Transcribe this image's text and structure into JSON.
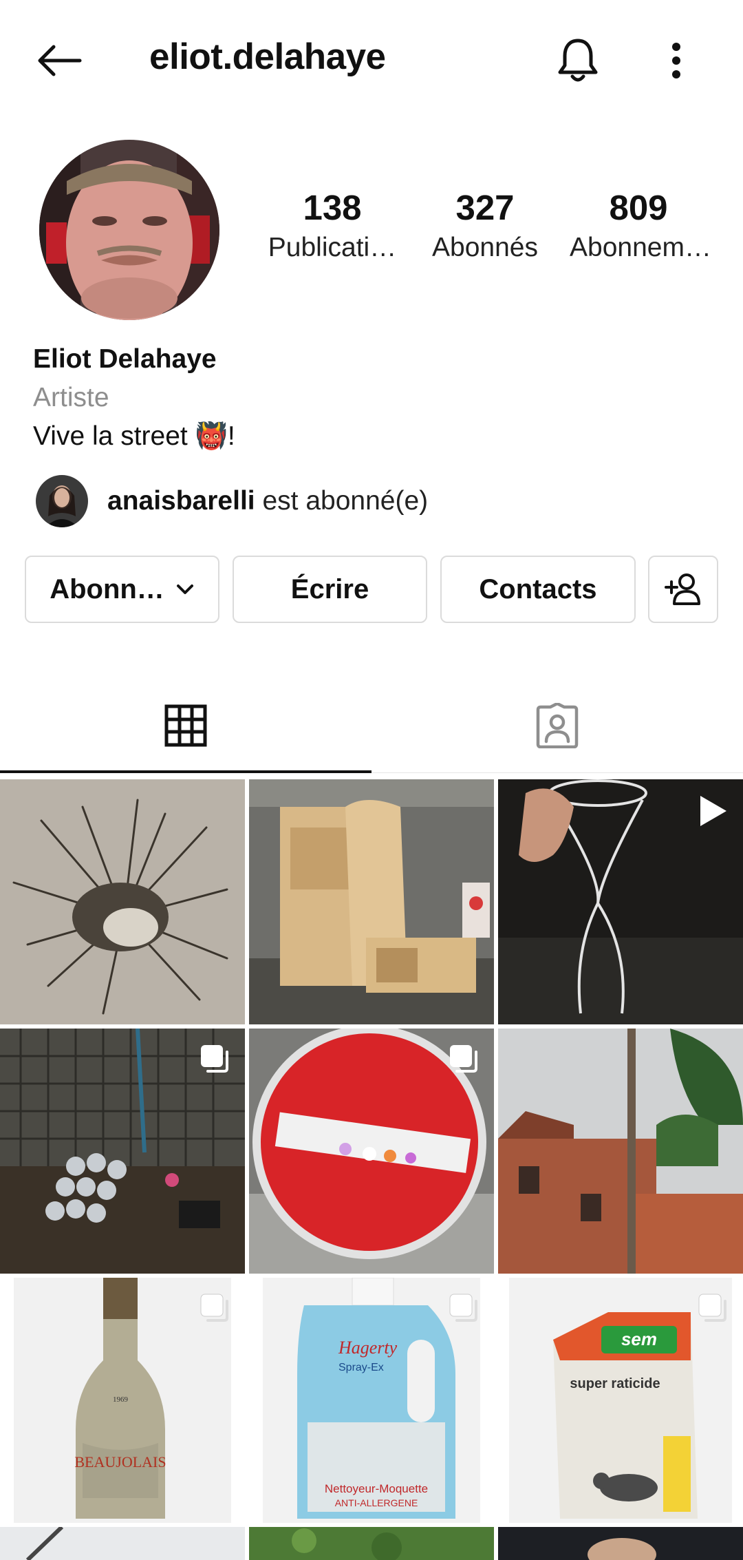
{
  "header": {
    "username": "eliot.delahaye",
    "back_icon": "arrow-left-icon",
    "bell_icon": "bell-icon",
    "more_icon": "more-vertical-icon"
  },
  "profile": {
    "stats": [
      {
        "value": "138",
        "label": "Publicati…"
      },
      {
        "value": "327",
        "label": "Abonnés"
      },
      {
        "value": "809",
        "label": "Abonnem…"
      }
    ],
    "name": "Eliot Delahaye",
    "category": "Artiste",
    "bio_text": "Vive la street ",
    "bio_emoji": "👹",
    "bio_suffix": "!",
    "followed_by_user": "anaisbarelli",
    "followed_by_suffix": " est abonné(e)"
  },
  "actions": {
    "following_label": "Abonn…",
    "message_label": "Écrire",
    "contacts_label": "Contacts"
  },
  "tabs": [
    {
      "name": "grid",
      "icon": "grid-icon",
      "active": true
    },
    {
      "name": "tagged",
      "icon": "tagged-person-icon",
      "active": false
    }
  ],
  "colors": {
    "border": "#dbdbdb",
    "muted": "#8e8e8e",
    "text": "#111111"
  },
  "posts": [
    {
      "subject": "paint splatter",
      "badge": "none"
    },
    {
      "subject": "abandoned furniture",
      "badge": "none"
    },
    {
      "subject": "wire lamp frame",
      "badge": "video-icon"
    },
    {
      "subject": "cans on fence",
      "badge": "carousel-icon"
    },
    {
      "subject": "no-entry sign",
      "badge": "carousel-icon"
    },
    {
      "subject": "cut tree and house",
      "badge": "none"
    },
    {
      "subject": "wine bottle",
      "badge": "carousel-icon"
    },
    {
      "subject": "spray bottle",
      "badge": "carousel-icon"
    },
    {
      "subject": "rat poison box",
      "badge": "carousel-icon"
    }
  ],
  "post_labels": {
    "bottle_year": "1969",
    "bottle_name": "BEAUJOLAIS",
    "spray_brand": "Hagerty",
    "spray_name": "Spray-Ex",
    "spray_line1": "Nettoyeur-Moquette",
    "spray_line2": "ANTI-ALLERGENE",
    "box_brand": "sem",
    "box_name": "super raticide"
  }
}
